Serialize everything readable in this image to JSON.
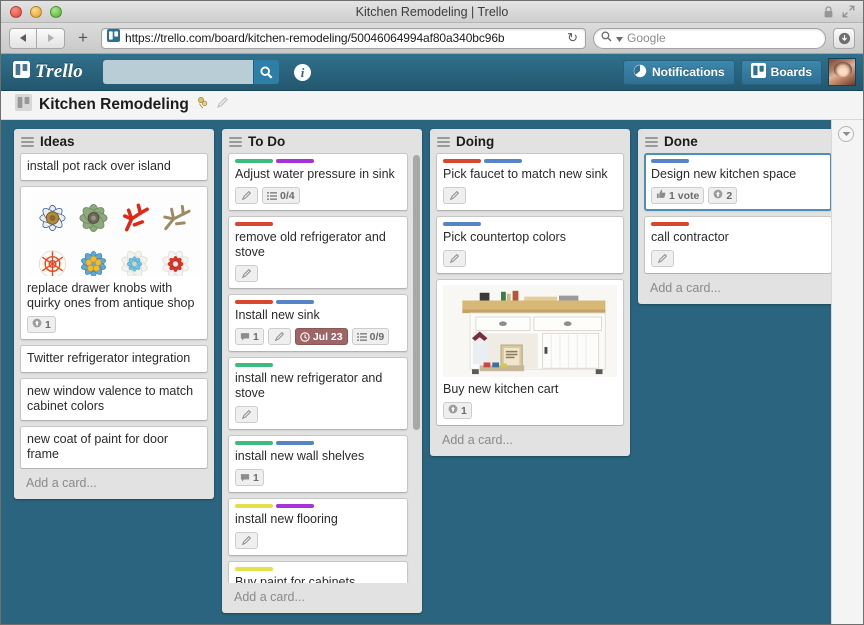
{
  "window": {
    "title": "Kitchen Remodeling | Trello",
    "traffic_lights": [
      "close",
      "minimize",
      "zoom"
    ],
    "lock_icon": "lock-icon",
    "fullscreen_icon": "fullscreen-icon"
  },
  "browser": {
    "back_label": "Back",
    "forward_label": "Forward",
    "add_tab_label": "+",
    "url": "https://trello.com/board/kitchen-remodeling/50046064994af80a340bc96b",
    "url_site_icon": "trello-board-icon",
    "reload_icon": "reload-icon",
    "search_placeholder": "Google",
    "search_value": "",
    "search_icon": "magnifier-icon",
    "downloads_icon": "downloads-icon"
  },
  "header": {
    "logo_text": "Trello",
    "logo_icon": "trello-board-icon",
    "search_value": "",
    "search_placeholder": "",
    "search_button_icon": "magnifier-icon",
    "info_icon": "info-icon",
    "info_label": "i",
    "notifications_label": "Notifications",
    "notifications_icon": "notifications-circle-icon",
    "boards_label": "Boards",
    "boards_icon": "trello-board-icon",
    "avatar_name": "user-avatar"
  },
  "board_bar": {
    "icon": "trello-board-icon",
    "title": "Kitchen Remodeling",
    "visibility_icon": "organization-icon",
    "edit_icon": "pencil-icon"
  },
  "board": {
    "sidebar_toggle_icon": "chevron-down-circle-icon",
    "add_card_label": "Add a card...",
    "label_colors": {
      "green": "#3ebb7e",
      "purple": "#a632db",
      "red": "#d9452e",
      "blue": "#5584c8",
      "yellow": "#e3e04a"
    },
    "lists": [
      {
        "title": "Ideas",
        "menu_icon": "list-menu-icon",
        "has_scrollbar": false,
        "cards": [
          {
            "title": "install pot rack over island",
            "labels": [],
            "badges": []
          },
          {
            "title": "replace drawer knobs with quirky ones from antique shop",
            "labels": [],
            "image": "drawer-knobs-photo",
            "badges": [
              {
                "type": "attachment",
                "icon": "attachment-icon",
                "text": "1"
              }
            ]
          },
          {
            "title": "Twitter refrigerator integration",
            "labels": [],
            "badges": []
          },
          {
            "title": "new window valence to match cabinet colors",
            "labels": [],
            "badges": []
          },
          {
            "title": "new coat of paint for door frame",
            "labels": [],
            "badges": []
          }
        ]
      },
      {
        "title": "To Do",
        "menu_icon": "list-menu-icon",
        "has_scrollbar": true,
        "cards": [
          {
            "title": "Adjust water pressure in sink",
            "labels": [
              "green",
              "purple"
            ],
            "badges": [
              {
                "type": "description",
                "icon": "pencil-icon",
                "text": ""
              },
              {
                "type": "checklist",
                "icon": "checklist-icon",
                "text": "0/4"
              }
            ]
          },
          {
            "title": "remove old refrigerator and stove",
            "labels": [
              "red"
            ],
            "badges": [
              {
                "type": "description",
                "icon": "pencil-icon",
                "text": ""
              }
            ]
          },
          {
            "title": "Install new sink",
            "labels": [
              "red",
              "blue"
            ],
            "badges": [
              {
                "type": "comments",
                "icon": "comment-icon",
                "text": "1"
              },
              {
                "type": "description",
                "icon": "pencil-icon",
                "text": ""
              },
              {
                "type": "due",
                "icon": "clock-icon",
                "text": "Jul 23"
              },
              {
                "type": "checklist",
                "icon": "checklist-icon",
                "text": "0/9"
              }
            ]
          },
          {
            "title": "install new refrigerator and stove",
            "labels": [
              "green"
            ],
            "badges": [
              {
                "type": "description",
                "icon": "pencil-icon",
                "text": ""
              }
            ]
          },
          {
            "title": "install new wall shelves",
            "labels": [
              "green",
              "blue"
            ],
            "badges": [
              {
                "type": "comments",
                "icon": "comment-icon",
                "text": "1"
              }
            ]
          },
          {
            "title": "install new flooring",
            "labels": [
              "yellow",
              "purple"
            ],
            "badges": [
              {
                "type": "description",
                "icon": "pencil-icon",
                "text": ""
              }
            ]
          },
          {
            "title": "Buy paint for cabinets",
            "labels": [
              "yellow"
            ],
            "badges": [
              {
                "type": "description",
                "icon": "pencil-icon",
                "text": ""
              }
            ]
          }
        ]
      },
      {
        "title": "Doing",
        "menu_icon": "list-menu-icon",
        "has_scrollbar": false,
        "cards": [
          {
            "title": "Pick faucet to match new sink",
            "labels": [
              "red",
              "blue"
            ],
            "badges": [
              {
                "type": "description",
                "icon": "pencil-icon",
                "text": ""
              }
            ]
          },
          {
            "title": "Pick countertop colors",
            "labels": [
              "blue"
            ],
            "badges": [
              {
                "type": "description",
                "icon": "pencil-icon",
                "text": ""
              }
            ]
          },
          {
            "title": "Buy new kitchen cart",
            "labels": [],
            "image": "kitchen-cart-photo",
            "badges": [
              {
                "type": "attachment",
                "icon": "attachment-icon",
                "text": "1"
              }
            ]
          }
        ]
      },
      {
        "title": "Done",
        "menu_icon": "list-menu-icon",
        "has_scrollbar": false,
        "cards": [
          {
            "title": "Design new kitchen space",
            "labels": [
              "blue"
            ],
            "selected": true,
            "badges": [
              {
                "type": "votes",
                "icon": "thumbs-up-icon",
                "text": "1 vote"
              },
              {
                "type": "attachment",
                "icon": "attachment-icon",
                "text": "2"
              }
            ]
          },
          {
            "title": "call contractor",
            "labels": [
              "red"
            ],
            "badges": [
              {
                "type": "description",
                "icon": "pencil-icon",
                "text": ""
              }
            ]
          }
        ]
      }
    ]
  }
}
